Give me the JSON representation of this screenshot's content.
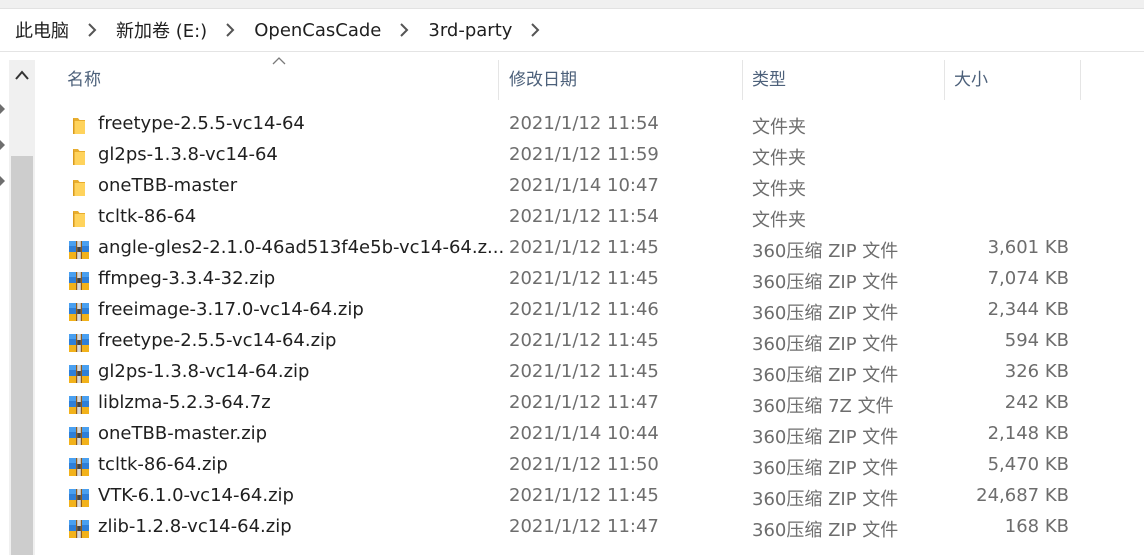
{
  "breadcrumb": [
    "此电脑",
    "新加卷 (E:)",
    "OpenCasCade",
    "3rd-party"
  ],
  "columns": {
    "name": "名称",
    "date": "修改日期",
    "type": "类型",
    "size": "大小"
  },
  "sort_indicator": "chevron-up-icon",
  "files": [
    {
      "name": "freetype-2.5.5-vc14-64",
      "date": "2021/1/12 11:54",
      "type": "文件夹",
      "size": "",
      "icon": "folder-icon"
    },
    {
      "name": "gl2ps-1.3.8-vc14-64",
      "date": "2021/1/12 11:59",
      "type": "文件夹",
      "size": "",
      "icon": "folder-icon"
    },
    {
      "name": "oneTBB-master",
      "date": "2021/1/14 10:47",
      "type": "文件夹",
      "size": "",
      "icon": "folder-icon"
    },
    {
      "name": "tcltk-86-64",
      "date": "2021/1/12 11:54",
      "type": "文件夹",
      "size": "",
      "icon": "folder-icon"
    },
    {
      "name": "angle-gles2-2.1.0-46ad513f4e5b-vc14-64.z...",
      "date": "2021/1/12 11:45",
      "type": "360压缩 ZIP 文件",
      "size": "3,601 KB",
      "icon": "zip-archive-icon"
    },
    {
      "name": "ffmpeg-3.3.4-32.zip",
      "date": "2021/1/12 11:45",
      "type": "360压缩 ZIP 文件",
      "size": "7,074 KB",
      "icon": "zip-archive-icon"
    },
    {
      "name": "freeimage-3.17.0-vc14-64.zip",
      "date": "2021/1/12 11:46",
      "type": "360压缩 ZIP 文件",
      "size": "2,344 KB",
      "icon": "zip-archive-icon"
    },
    {
      "name": "freetype-2.5.5-vc14-64.zip",
      "date": "2021/1/12 11:45",
      "type": "360压缩 ZIP 文件",
      "size": "594 KB",
      "icon": "zip-archive-icon"
    },
    {
      "name": "gl2ps-1.3.8-vc14-64.zip",
      "date": "2021/1/12 11:45",
      "type": "360压缩 ZIP 文件",
      "size": "326 KB",
      "icon": "zip-archive-icon"
    },
    {
      "name": "liblzma-5.2.3-64.7z",
      "date": "2021/1/12 11:47",
      "type": "360压缩 7Z 文件",
      "size": "242 KB",
      "icon": "zip-archive-icon"
    },
    {
      "name": "oneTBB-master.zip",
      "date": "2021/1/14 10:44",
      "type": "360压缩 ZIP 文件",
      "size": "2,148 KB",
      "icon": "zip-archive-icon"
    },
    {
      "name": "tcltk-86-64.zip",
      "date": "2021/1/12 11:50",
      "type": "360压缩 ZIP 文件",
      "size": "5,470 KB",
      "icon": "zip-archive-icon"
    },
    {
      "name": "VTK-6.1.0-vc14-64.zip",
      "date": "2021/1/12 11:45",
      "type": "360压缩 ZIP 文件",
      "size": "24,687 KB",
      "icon": "zip-archive-icon"
    },
    {
      "name": "zlib-1.2.8-vc14-64.zip",
      "date": "2021/1/12 11:47",
      "type": "360压缩 ZIP 文件",
      "size": "168 KB",
      "icon": "zip-archive-icon"
    }
  ],
  "colors": {
    "header_text": "#4c607a",
    "folder": "#f5c242",
    "meta_text": "#6d6d6d"
  }
}
